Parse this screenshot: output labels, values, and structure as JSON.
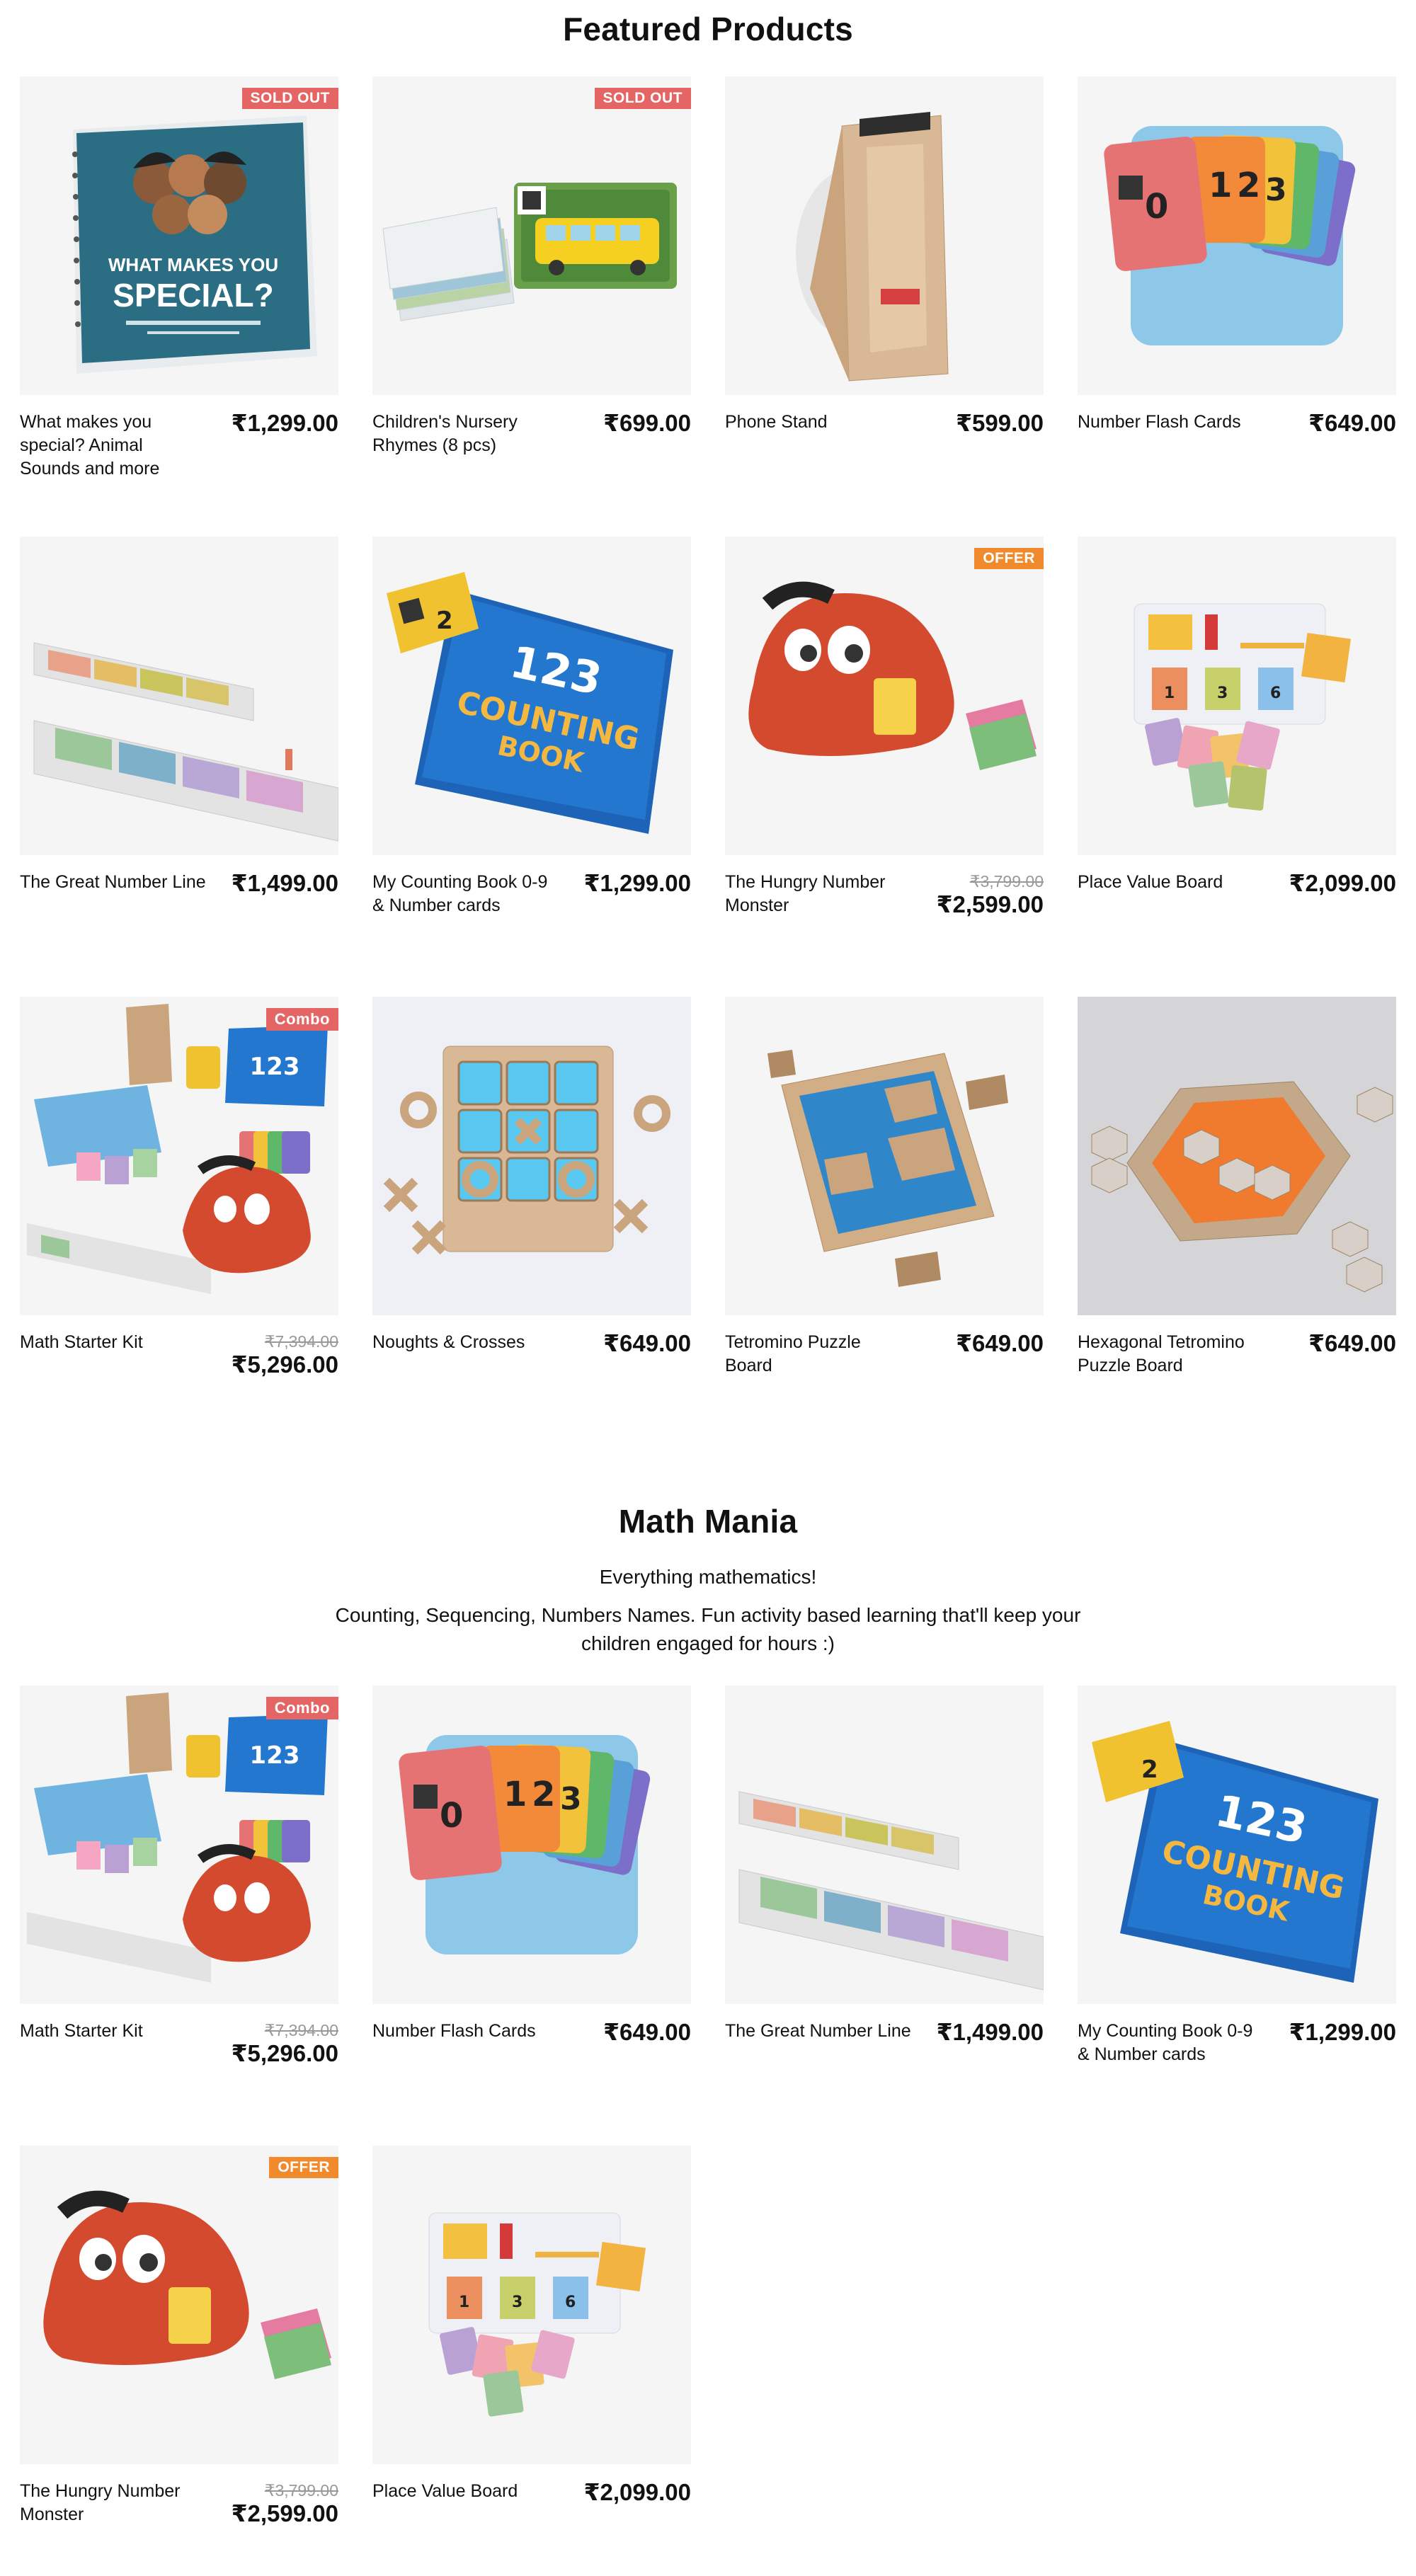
{
  "featured": {
    "title": "Featured Products",
    "products": [
      {
        "name": "What makes you special? Animal Sounds and more",
        "price": "₹1,299.00",
        "badge": "SOLD OUT"
      },
      {
        "name": "Children's Nursery Rhymes (8 pcs)",
        "price": "₹699.00",
        "badge": "SOLD OUT"
      },
      {
        "name": "Phone Stand",
        "price": "₹599.00"
      },
      {
        "name": "Number Flash Cards",
        "price": "₹649.00"
      },
      {
        "name": "The Great Number Line",
        "price": "₹1,499.00"
      },
      {
        "name": "My Counting Book 0-9 & Number cards",
        "price": "₹1,299.00"
      },
      {
        "name": "The Hungry Number Monster",
        "old_price": "₹3,799.00",
        "price": "₹2,599.00",
        "badge": "OFFER"
      },
      {
        "name": "Place Value Board",
        "price": "₹2,099.00"
      },
      {
        "name": "Math Starter Kit",
        "old_price": "₹7,394.00",
        "price": "₹5,296.00",
        "badge": "Combo"
      },
      {
        "name": "Noughts & Crosses",
        "price": "₹649.00"
      },
      {
        "name": "Tetromino Puzzle Board",
        "price": "₹649.00"
      },
      {
        "name": "Hexagonal Tetromino Puzzle Board",
        "price": "₹649.00"
      }
    ]
  },
  "math": {
    "title": "Math Mania",
    "subtitle": "Everything mathematics!",
    "description": "Counting, Sequencing, Numbers Names. Fun activity based learning that'll keep your children engaged for hours :)",
    "products": [
      {
        "name": "Math Starter Kit",
        "old_price": "₹7,394.00",
        "price": "₹5,296.00",
        "badge": "Combo"
      },
      {
        "name": "Number Flash Cards",
        "price": "₹649.00"
      },
      {
        "name": "The Great Number Line",
        "price": "₹1,499.00"
      },
      {
        "name": "My Counting Book 0-9 & Number cards",
        "price": "₹1,299.00"
      },
      {
        "name": "The Hungry Number Monster",
        "old_price": "₹3,799.00",
        "price": "₹2,599.00",
        "badge": "OFFER"
      },
      {
        "name": "Place Value Board",
        "price": "₹2,099.00"
      }
    ]
  },
  "images": {
    "book": {
      "title1": "WHAT MAKES YOU",
      "title2": "SPECIAL?"
    },
    "counting_book": {
      "title1": "123",
      "title2": "COUNTING",
      "title3": "BOOK"
    },
    "flash_digits": [
      "0",
      "1",
      "2",
      "3"
    ],
    "pvb_digits": [
      "1",
      "3",
      "6"
    ]
  },
  "colors": {
    "sold_out": "#e46564",
    "offer": "#f08a2c",
    "combo": "#e46564",
    "card_bg": "#f5f5f5"
  }
}
